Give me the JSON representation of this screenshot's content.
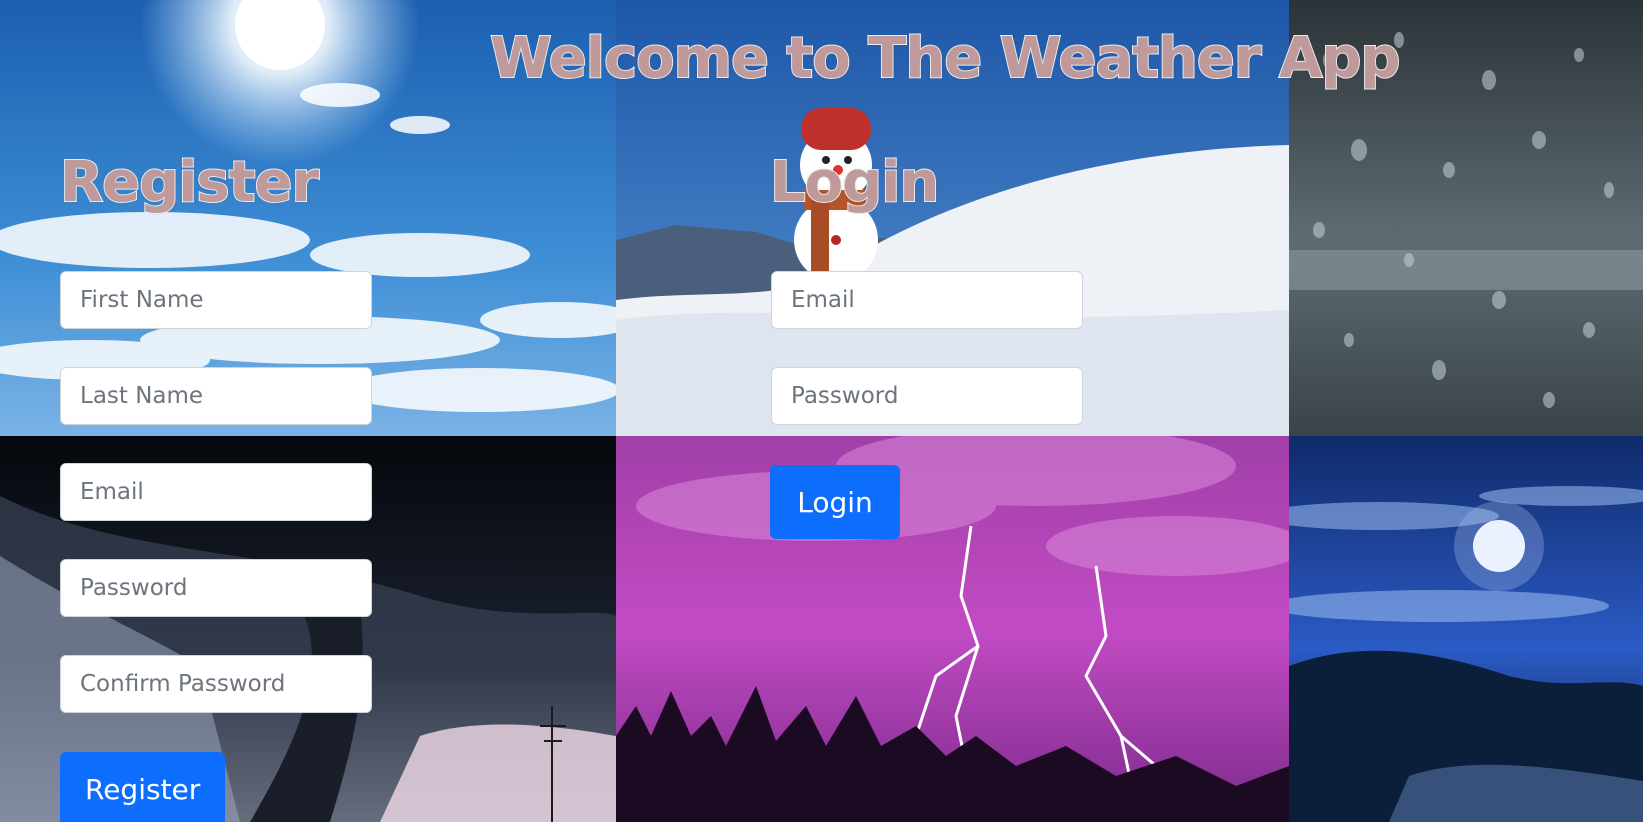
{
  "page": {
    "title": "Welcome to The Weather App"
  },
  "register": {
    "heading": "Register",
    "first_name_placeholder": "First Name",
    "last_name_placeholder": "Last Name",
    "email_placeholder": "Email",
    "password_placeholder": "Password",
    "confirm_password_placeholder": "Confirm Password",
    "button_label": "Register"
  },
  "login": {
    "heading": "Login",
    "email_placeholder": "Email",
    "password_placeholder": "Password",
    "button_label": "Login"
  },
  "colors": {
    "heading_fill": "#c09a9a",
    "primary_button": "#0d6efd"
  }
}
